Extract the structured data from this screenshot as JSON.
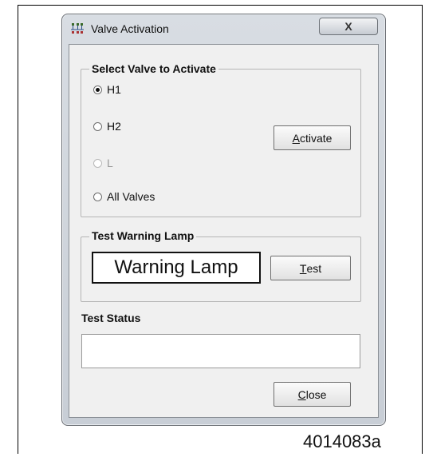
{
  "window": {
    "title": "Valve Activation",
    "close_glyph": "X"
  },
  "valve_group": {
    "legend": "Select Valve to Activate",
    "options": [
      {
        "label": "H1",
        "checked": true,
        "enabled": true
      },
      {
        "label": "H2",
        "checked": false,
        "enabled": true
      },
      {
        "label": "L",
        "checked": false,
        "enabled": false
      },
      {
        "label": "All Valves",
        "checked": false,
        "enabled": true
      }
    ],
    "activate_button": {
      "mnemonic": "A",
      "rest": "ctivate"
    }
  },
  "lamp_group": {
    "legend": "Test Warning Lamp",
    "lamp_label": "Warning Lamp",
    "test_button": {
      "mnemonic": "T",
      "rest": "est"
    }
  },
  "status": {
    "label": "Test Status",
    "value": ""
  },
  "close_button": {
    "mnemonic": "C",
    "rest": "lose"
  },
  "figure_id": "4014083a",
  "icons": {
    "app": "valve-network-icon",
    "close": "close-icon"
  },
  "colors": {
    "window_frame": "#c8ced6",
    "client_bg": "#f0f0f0"
  }
}
